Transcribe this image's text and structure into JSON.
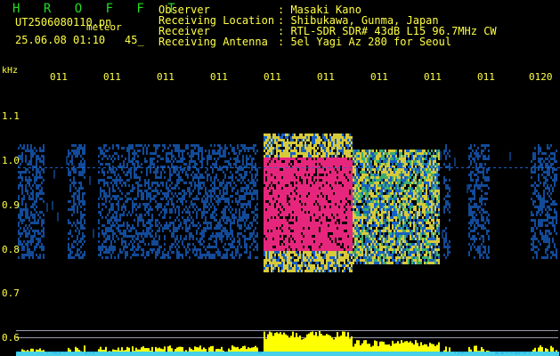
{
  "header": {
    "title": "H R O F F T",
    "file_name": "UT2506080110.pn",
    "file_tag": "meteor",
    "datetime": "25.06.08 01:10",
    "seconds": "45_",
    "labels": [
      {
        "label": "Observer",
        "value": ": Masaki Kano"
      },
      {
        "label": "Receiving Location",
        "value": ": Shibukawa, Gunma, Japan"
      },
      {
        "label": "Receiver",
        "value": ": RTL-SDR SDR# 43dB L15 96.7MHz CW"
      },
      {
        "label": "Receiving Antenna",
        "value": ": 5el Yagi Az 280 for Seoul"
      }
    ]
  },
  "chart_data": {
    "type": "heatmap",
    "ylabel": "kHz",
    "y_ticks": [
      "1.1",
      "1.0",
      "0.9",
      "0.8",
      "0.7",
      "0.6"
    ],
    "x_ticks": [
      "011",
      "011",
      "011",
      "011",
      "011",
      "011",
      "011",
      "011",
      "011",
      "0120"
    ],
    "ylim": [
      0.6,
      1.15
    ]
  },
  "colors": {
    "background": "#000000",
    "text": "#ffff44",
    "title": "#22dd22",
    "strong": "#ff2a8a",
    "medium": "#f0e040",
    "weak": "#1a6ad8",
    "amplitude": "#ffff00",
    "noise_floor": "#33ccff"
  }
}
